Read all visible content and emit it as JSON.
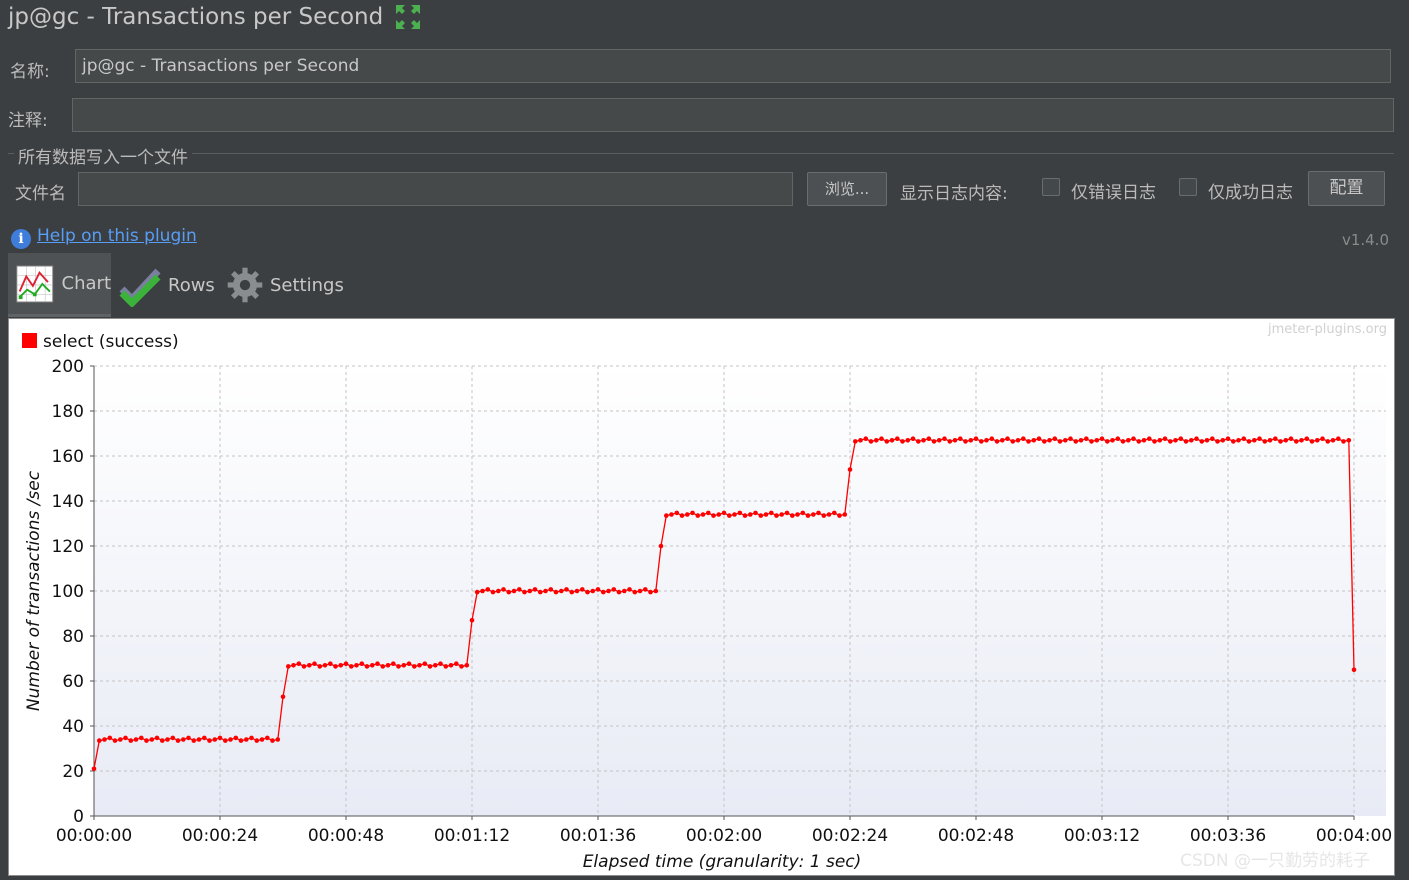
{
  "window": {
    "title": "jp@gc - Transactions per Second"
  },
  "form": {
    "name_label": "名称:",
    "name_value": "jp@gc - Transactions per Second",
    "comment_label": "注释:",
    "comment_value": "",
    "file_group_title": "所有数据写入一个文件",
    "filename_label": "文件名",
    "filename_value": "",
    "browse_button": "浏览...",
    "log_content_label": "显示日志内容:",
    "errors_only_label": "仅错误日志",
    "success_only_label": "仅成功日志",
    "configure_button": "配置"
  },
  "help": {
    "link_text": "Help on this plugin",
    "version": "v1.4.0"
  },
  "tabs": [
    {
      "label": "Chart",
      "icon": "chart-icon",
      "active": true
    },
    {
      "label": "Rows",
      "icon": "checkmark-icon",
      "active": false
    },
    {
      "label": "Settings",
      "icon": "gear-icon",
      "active": false
    }
  ],
  "chart_credit": "jmeter-plugins.org",
  "watermark": "CSDN @一只勤劳的耗子",
  "chart_data": {
    "type": "line",
    "title": "",
    "xlabel": "Elapsed time (granularity: 1 sec)",
    "ylabel": "Number of transactions /sec",
    "ylim": [
      0,
      200
    ],
    "yticks": [
      "0",
      "20",
      "40",
      "60",
      "80",
      "100",
      "120",
      "140",
      "160",
      "180",
      "200"
    ],
    "xlim": [
      0,
      240
    ],
    "xticks": [
      "00:00:00",
      "00:00:24",
      "00:00:48",
      "00:01:12",
      "00:01:36",
      "00:02:00",
      "00:02:24",
      "00:02:48",
      "00:03:12",
      "00:03:36",
      "00:04:00"
    ],
    "grid": true,
    "legend_position": "top-left",
    "series": [
      {
        "name": "select (success)",
        "color": "#ff0000",
        "segments": [
          {
            "x_from": 0,
            "x_to": 0,
            "value": 21
          },
          {
            "x_from": 1,
            "x_to": 35,
            "value": 34
          },
          {
            "x_from": 36,
            "x_to": 36,
            "value": 53
          },
          {
            "x_from": 37,
            "x_to": 71,
            "value": 67
          },
          {
            "x_from": 72,
            "x_to": 72,
            "value": 87
          },
          {
            "x_from": 73,
            "x_to": 107,
            "value": 100
          },
          {
            "x_from": 108,
            "x_to": 108,
            "value": 120
          },
          {
            "x_from": 109,
            "x_to": 143,
            "value": 134
          },
          {
            "x_from": 144,
            "x_to": 144,
            "value": 154
          },
          {
            "x_from": 145,
            "x_to": 239,
            "value": 167
          },
          {
            "x_from": 240,
            "x_to": 240,
            "value": 65
          }
        ]
      }
    ]
  }
}
